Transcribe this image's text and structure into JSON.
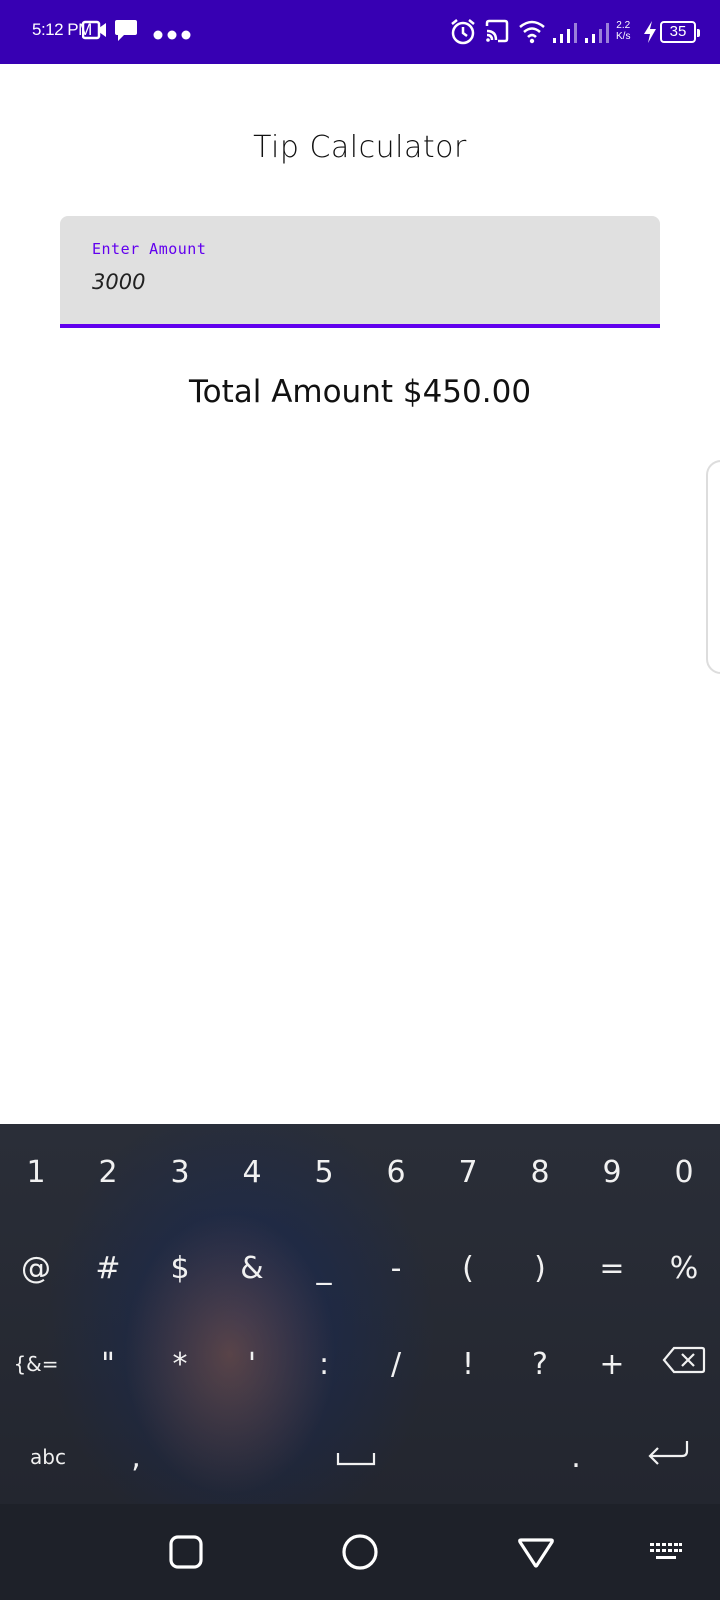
{
  "status_bar": {
    "time": "5:12 PM",
    "network_speed_value": "2.2",
    "network_speed_unit": "K/s",
    "battery_level": "35",
    "background_color": "#3700b3",
    "icons": [
      "video-camera-icon",
      "chat-bubble-icon",
      "more-dots-icon",
      "alarm-icon",
      "cast-icon",
      "wifi-icon",
      "signal-icon",
      "signal-icon",
      "charging-icon",
      "battery-icon"
    ]
  },
  "app": {
    "title": "Tip Calculator",
    "amount_field": {
      "label": "Enter Amount",
      "value": "3000"
    },
    "total_text": "Total Amount $450.00",
    "accent_color": "#6200ee"
  },
  "keyboard": {
    "row1": [
      "1",
      "2",
      "3",
      "4",
      "5",
      "6",
      "7",
      "8",
      "9",
      "0"
    ],
    "row2": [
      "@",
      "#",
      "$",
      "&",
      "_",
      "-",
      "(",
      ")",
      "=",
      "%"
    ],
    "row3": [
      "{&=",
      "\"",
      "*",
      "'",
      ":",
      "/",
      "!",
      "?",
      "+"
    ],
    "row3_icons": [
      "backspace-icon"
    ],
    "abc_label": "abc",
    "comma_label": ",",
    "dot_label": ".",
    "row4_icons": [
      "space-icon",
      "enter-icon"
    ]
  },
  "navigation": {
    "icons": [
      "recents-icon",
      "home-icon",
      "back-icon",
      "keyboard-icon"
    ]
  }
}
